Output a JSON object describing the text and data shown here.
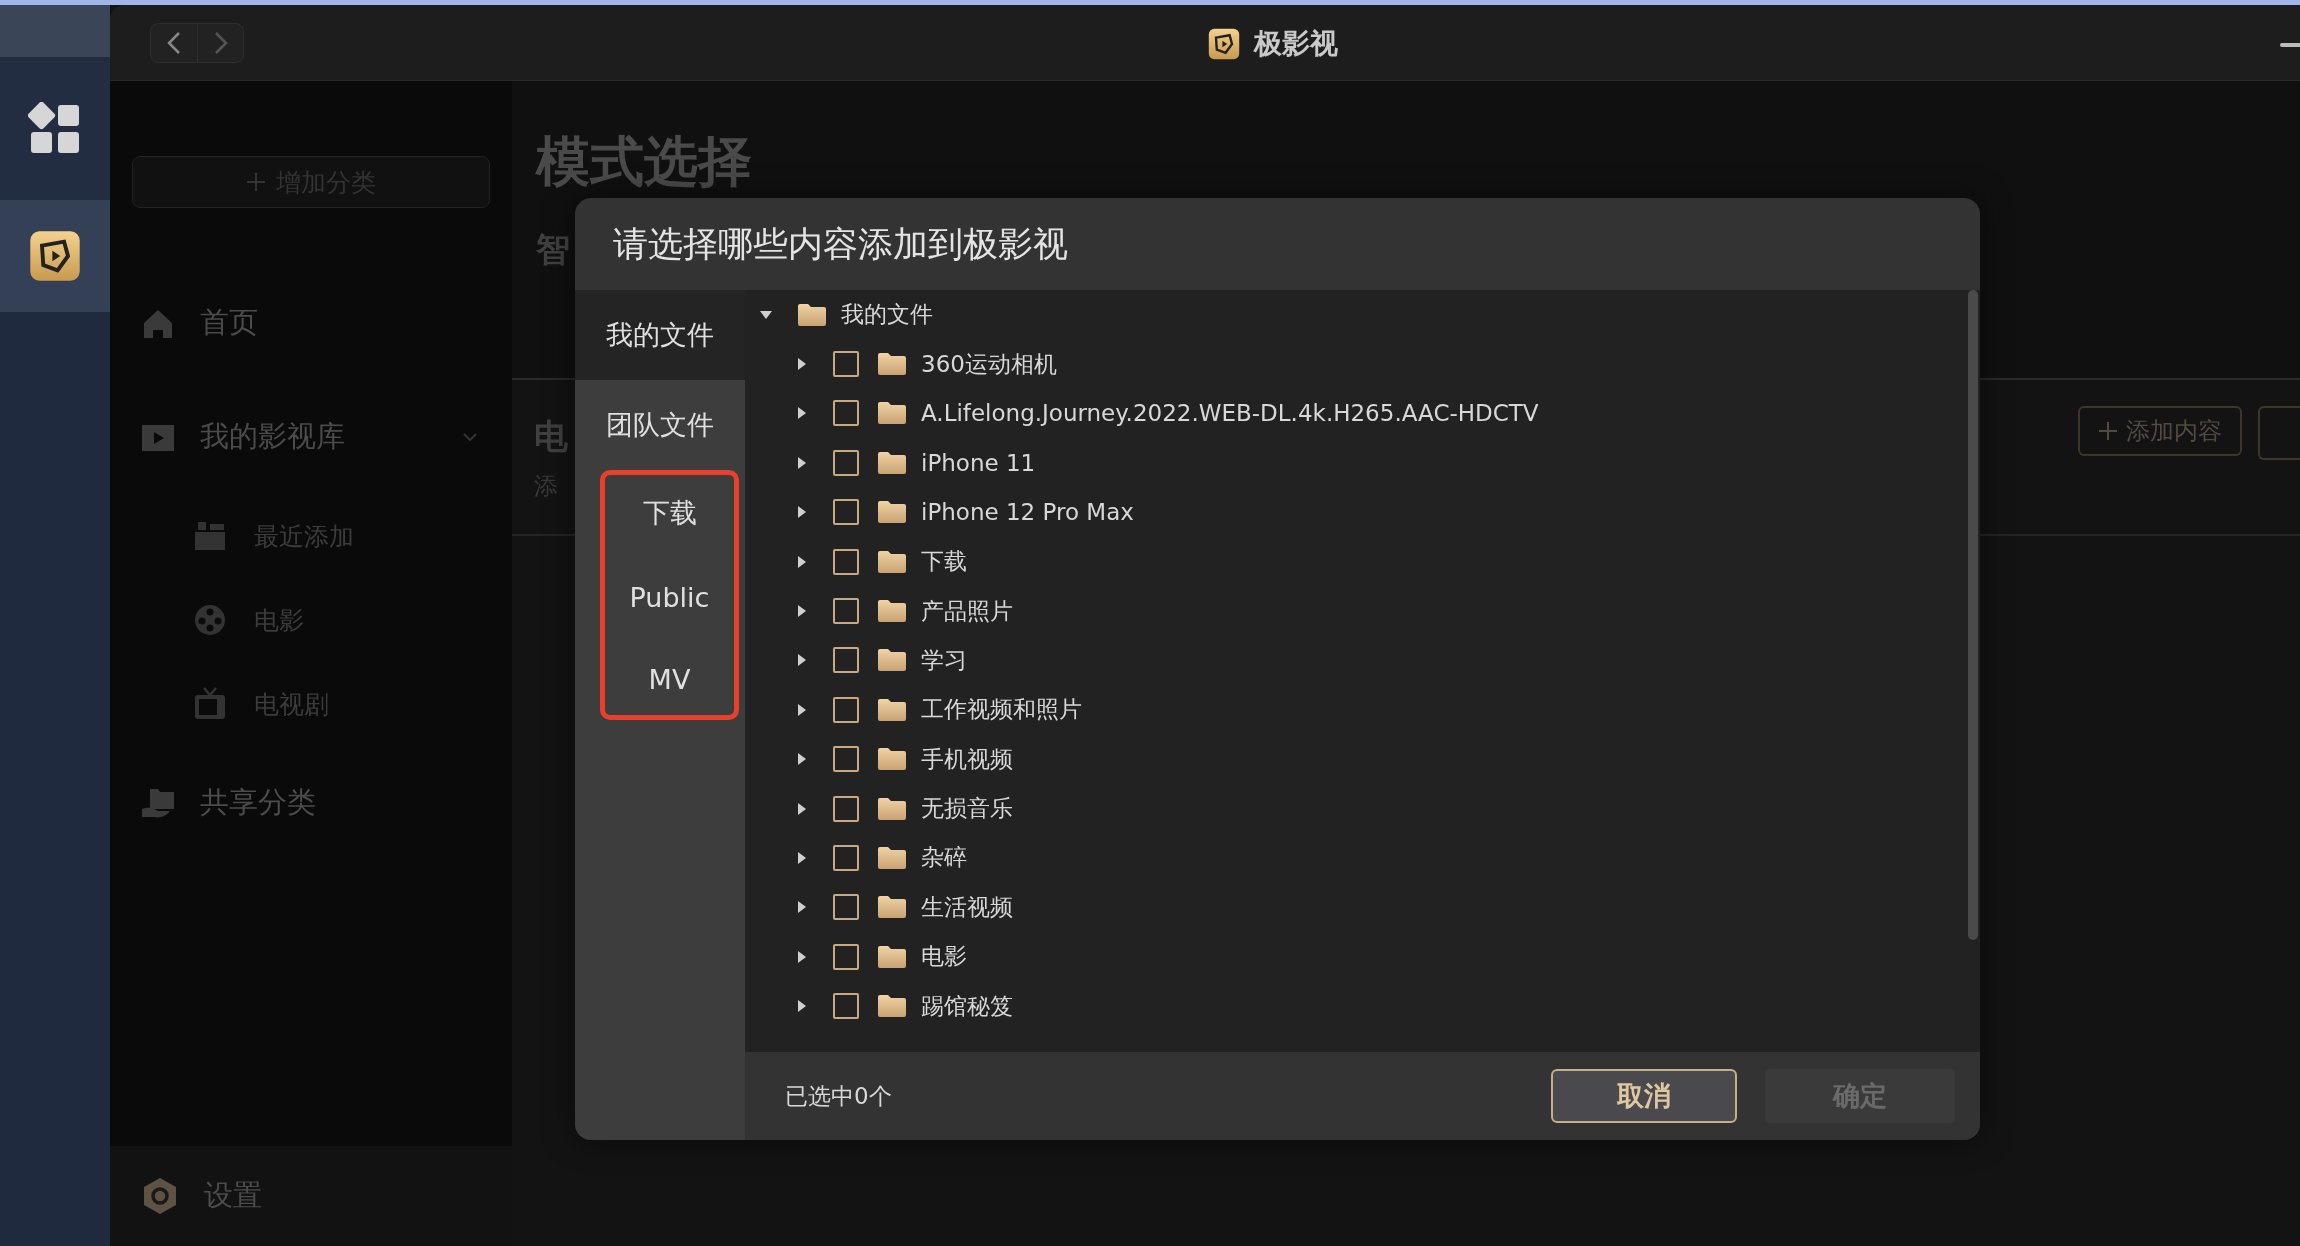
{
  "dock": [
    {
      "kind": "grid",
      "selected": false
    },
    {
      "kind": "logo",
      "selected": true
    }
  ],
  "window": {
    "title": "极影视"
  },
  "sidebar": {
    "add_button": "增加分类",
    "items": [
      {
        "kind": "home",
        "label": "首页"
      },
      {
        "kind": "library",
        "label": "我的影视库",
        "expanded": true,
        "children": [
          {
            "kind": "recent",
            "label": "最近添加"
          },
          {
            "kind": "movie",
            "label": "电影"
          },
          {
            "kind": "tv",
            "label": "电视剧"
          }
        ]
      },
      {
        "kind": "shared",
        "label": "共享分类"
      }
    ],
    "settings": "设置"
  },
  "content": {
    "title": "模式选择",
    "tab_fragment": "智",
    "section_fragment": "电",
    "caption_fragment": "添",
    "add_button": "添加内容"
  },
  "dialog": {
    "title": "请选择哪些内容添加到极影视",
    "sources": [
      {
        "label": "我的文件",
        "selected": true
      },
      {
        "label": "团队文件",
        "selected": false
      }
    ],
    "highlighted_folders": [
      "下载",
      "Public",
      "MV"
    ],
    "tree": {
      "label": "我的文件",
      "expanded": true,
      "children": [
        {
          "label": "360运动相机",
          "checked": false,
          "expanded": false
        },
        {
          "label": "A.Lifelong.Journey.2022.WEB-DL.4k.H265.AAC-HDCTV",
          "checked": false,
          "expanded": false
        },
        {
          "label": "iPhone 11",
          "checked": false,
          "expanded": false
        },
        {
          "label": "iPhone 12 Pro Max",
          "checked": false,
          "expanded": false
        },
        {
          "label": "下载",
          "checked": false,
          "expanded": false
        },
        {
          "label": "产品照片",
          "checked": false,
          "expanded": false
        },
        {
          "label": "学习",
          "checked": false,
          "expanded": false
        },
        {
          "label": "工作视频和照片",
          "checked": false,
          "expanded": false
        },
        {
          "label": "手机视频",
          "checked": false,
          "expanded": false
        },
        {
          "label": "无损音乐",
          "checked": false,
          "expanded": false
        },
        {
          "label": "杂碎",
          "checked": false,
          "expanded": false
        },
        {
          "label": "生活视频",
          "checked": false,
          "expanded": false
        },
        {
          "label": "电影",
          "checked": false,
          "expanded": false
        },
        {
          "label": "踢馆秘笈",
          "checked": false,
          "expanded": false
        }
      ]
    },
    "status": "已选中0个",
    "cancel": "取消",
    "confirm": {
      "label": "确定",
      "disabled": true
    }
  }
}
